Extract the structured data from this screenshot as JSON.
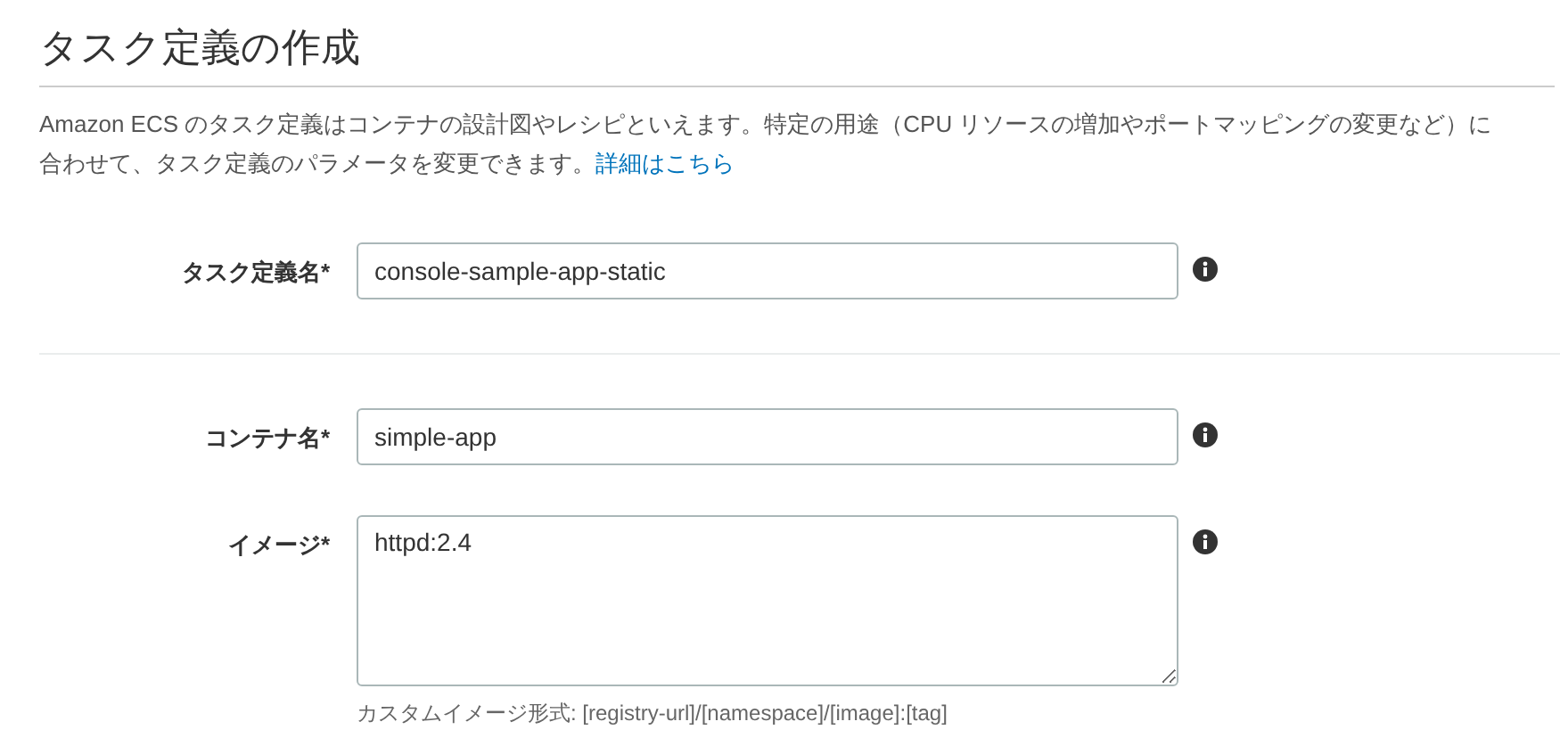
{
  "title": "タスク定義の作成",
  "description": {
    "text": "Amazon ECS のタスク定義はコンテナの設計図やレシピといえます。特定の用途（CPU リソースの増加やポートマッピングの変更など）に合わせて、タスク定義のパラメータを変更できます。",
    "link": "詳細はこちら"
  },
  "sections": [
    {
      "fields": [
        {
          "kind": "input",
          "label": "タスク定義名*",
          "value": "console-sample-app-static"
        }
      ]
    },
    {
      "fields": [
        {
          "kind": "input",
          "label": "コンテナ名*",
          "value": "simple-app"
        },
        {
          "kind": "textarea",
          "label": "イメージ*",
          "value": "httpd:2.4",
          "hint": "カスタムイメージ形式: [registry-url]/[namespace]/[image]:[tag]"
        }
      ]
    }
  ]
}
